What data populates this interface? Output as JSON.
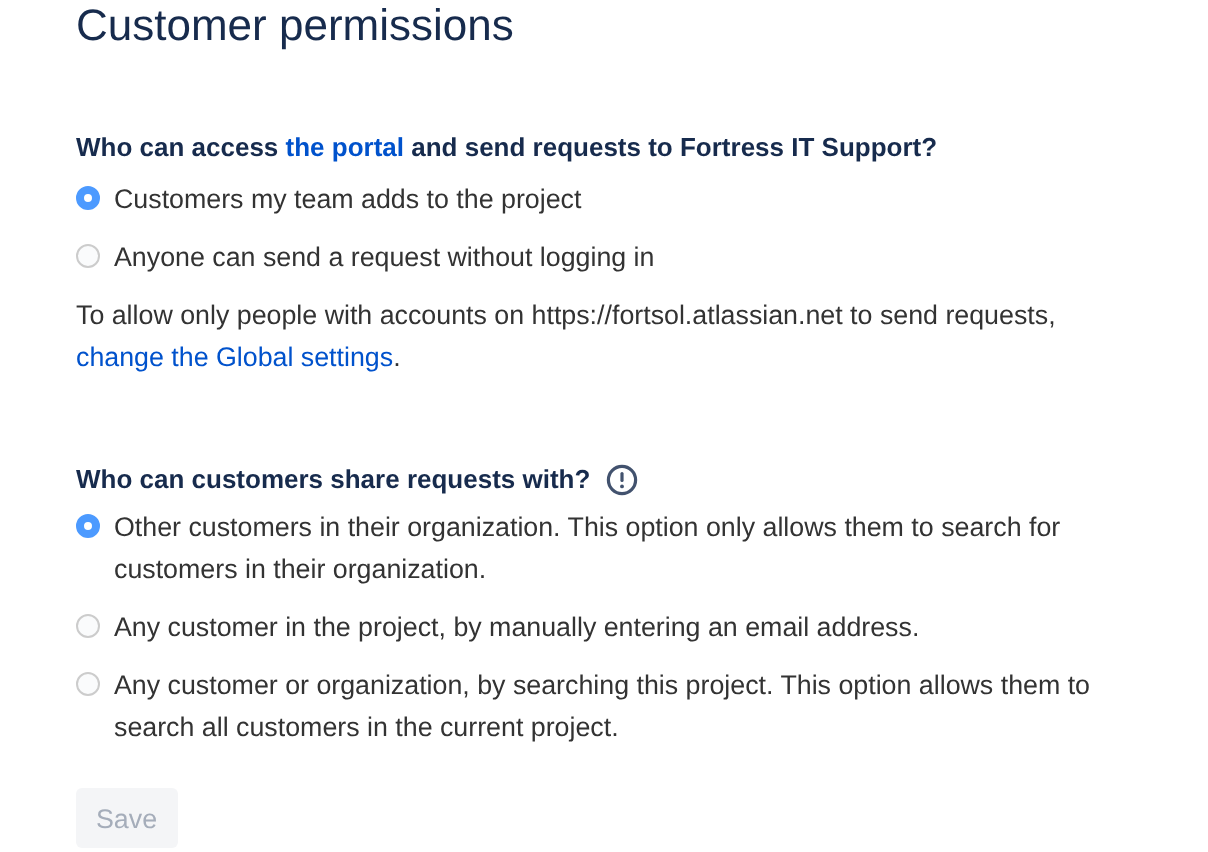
{
  "title": "Customer permissions",
  "access": {
    "heading": {
      "before": "Who can access ",
      "link": "the portal",
      "after": " and send requests to Fortress IT Support?"
    },
    "options": [
      {
        "label": "Customers my team adds to the project",
        "selected": true
      },
      {
        "label": "Anyone can send a request without logging in",
        "selected": false
      }
    ],
    "note": {
      "text": "To allow only people with accounts on https://fortsol.atlassian.net to send requests, ",
      "link": "change the Global settings",
      "after": "."
    }
  },
  "sharing": {
    "heading": "Who can customers share requests with?",
    "options": [
      {
        "label": "Other customers in their organization. This option only allows them to search for customers in their organization.",
        "selected": true
      },
      {
        "label": "Any customer in the project, by manually entering an email address.",
        "selected": false
      },
      {
        "label": "Any customer or organization, by searching this project. This option allows them to search all customers in the current project.",
        "selected": false
      }
    ]
  },
  "save": {
    "label": "Save",
    "disabled": true
  }
}
